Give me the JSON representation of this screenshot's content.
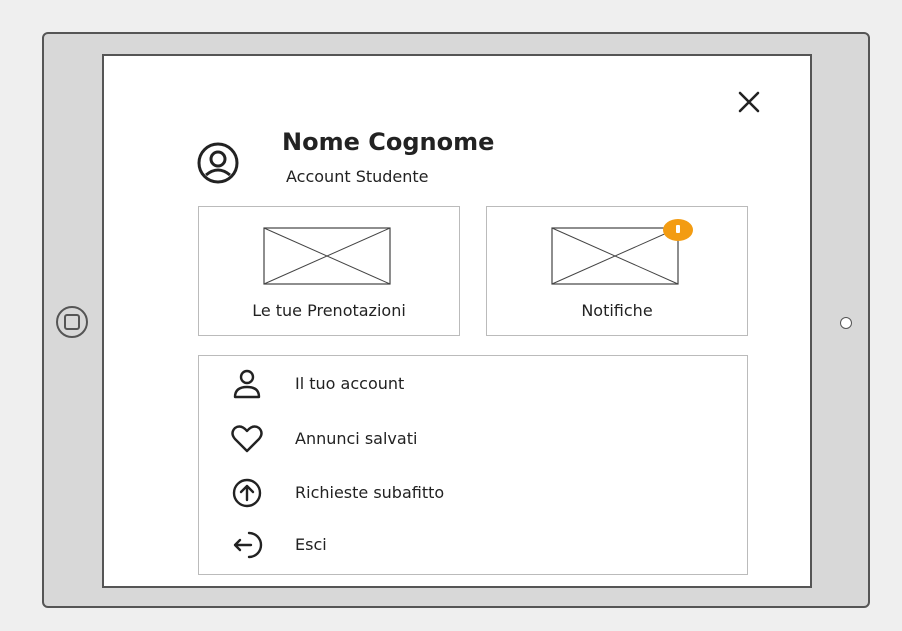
{
  "profile": {
    "name": "Nome Cognome",
    "role": "Account Studente"
  },
  "icons": {
    "close": "close-icon",
    "avatar": "user-circle-icon"
  },
  "tiles": [
    {
      "label": "Le tue Prenotazioni",
      "badge": false
    },
    {
      "label": "Notifiche",
      "badge": true
    }
  ],
  "menu": {
    "items": [
      {
        "label": "Il tuo account",
        "icon": "user-icon"
      },
      {
        "label": "Annunci salvati",
        "icon": "heart-icon"
      },
      {
        "label": "Richieste subafitto",
        "icon": "arrow-up-circle-icon"
      },
      {
        "label": "Esci",
        "icon": "logout-icon"
      }
    ]
  },
  "colors": {
    "badge": "#f39c12",
    "border": "#555555",
    "frame": "#d8d8d8"
  }
}
